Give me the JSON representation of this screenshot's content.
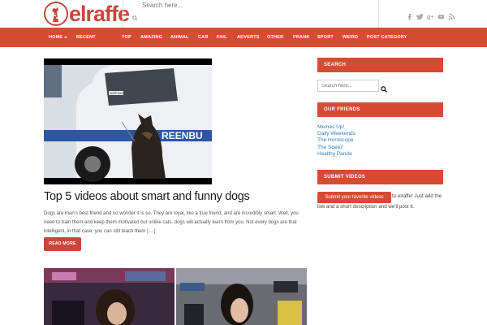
{
  "header": {
    "logo_text": "elraffe",
    "search_placeholder": "Search here..."
  },
  "social_icons": [
    "facebook-icon",
    "twitter-icon",
    "google-plus-icon",
    "youtube-icon",
    "rss-icon"
  ],
  "nav": {
    "items": [
      "HOME",
      "RECENT",
      "TOP",
      "AMAZING",
      "ANIMAL",
      "CAR",
      "FAIL",
      "ADVERTS",
      "OTHER",
      "PRANK",
      "SPORT",
      "WEIRD",
      "POST CATEGORY"
    ]
  },
  "post": {
    "title": "Top 5 videos about smart and funny dogs",
    "excerpt": "Dogs are man's best friend and no wonder it is so. They are loyal, like a true friend, and are incredibly smart. Well, you need to train them and keep them motivated but unlike cats, dogs will actually learn from you. Not every dogs are that intelligent, in that case, you can still teach them [....]",
    "read_more": "READ MORE",
    "image_text_door": "KEEP BACK",
    "image_text_side": "REENBU"
  },
  "sidebar": {
    "search_title": "SEARCH",
    "search_placeholder": "Search here...",
    "friends_title": "OUR FRIENDS",
    "friends": [
      "Memes Up!",
      "Daily Weekends",
      "The Horoscope",
      "The Sqeez",
      "Healthy Panda"
    ],
    "submit_title": "SUBMIT VIDEOS",
    "submit_button": "Submit your favorite videos",
    "submit_text": "to elraffe! Just add the link and a short description and we'll post it."
  },
  "colors": {
    "accent": "#d64b32",
    "link": "#2f7fb7"
  }
}
